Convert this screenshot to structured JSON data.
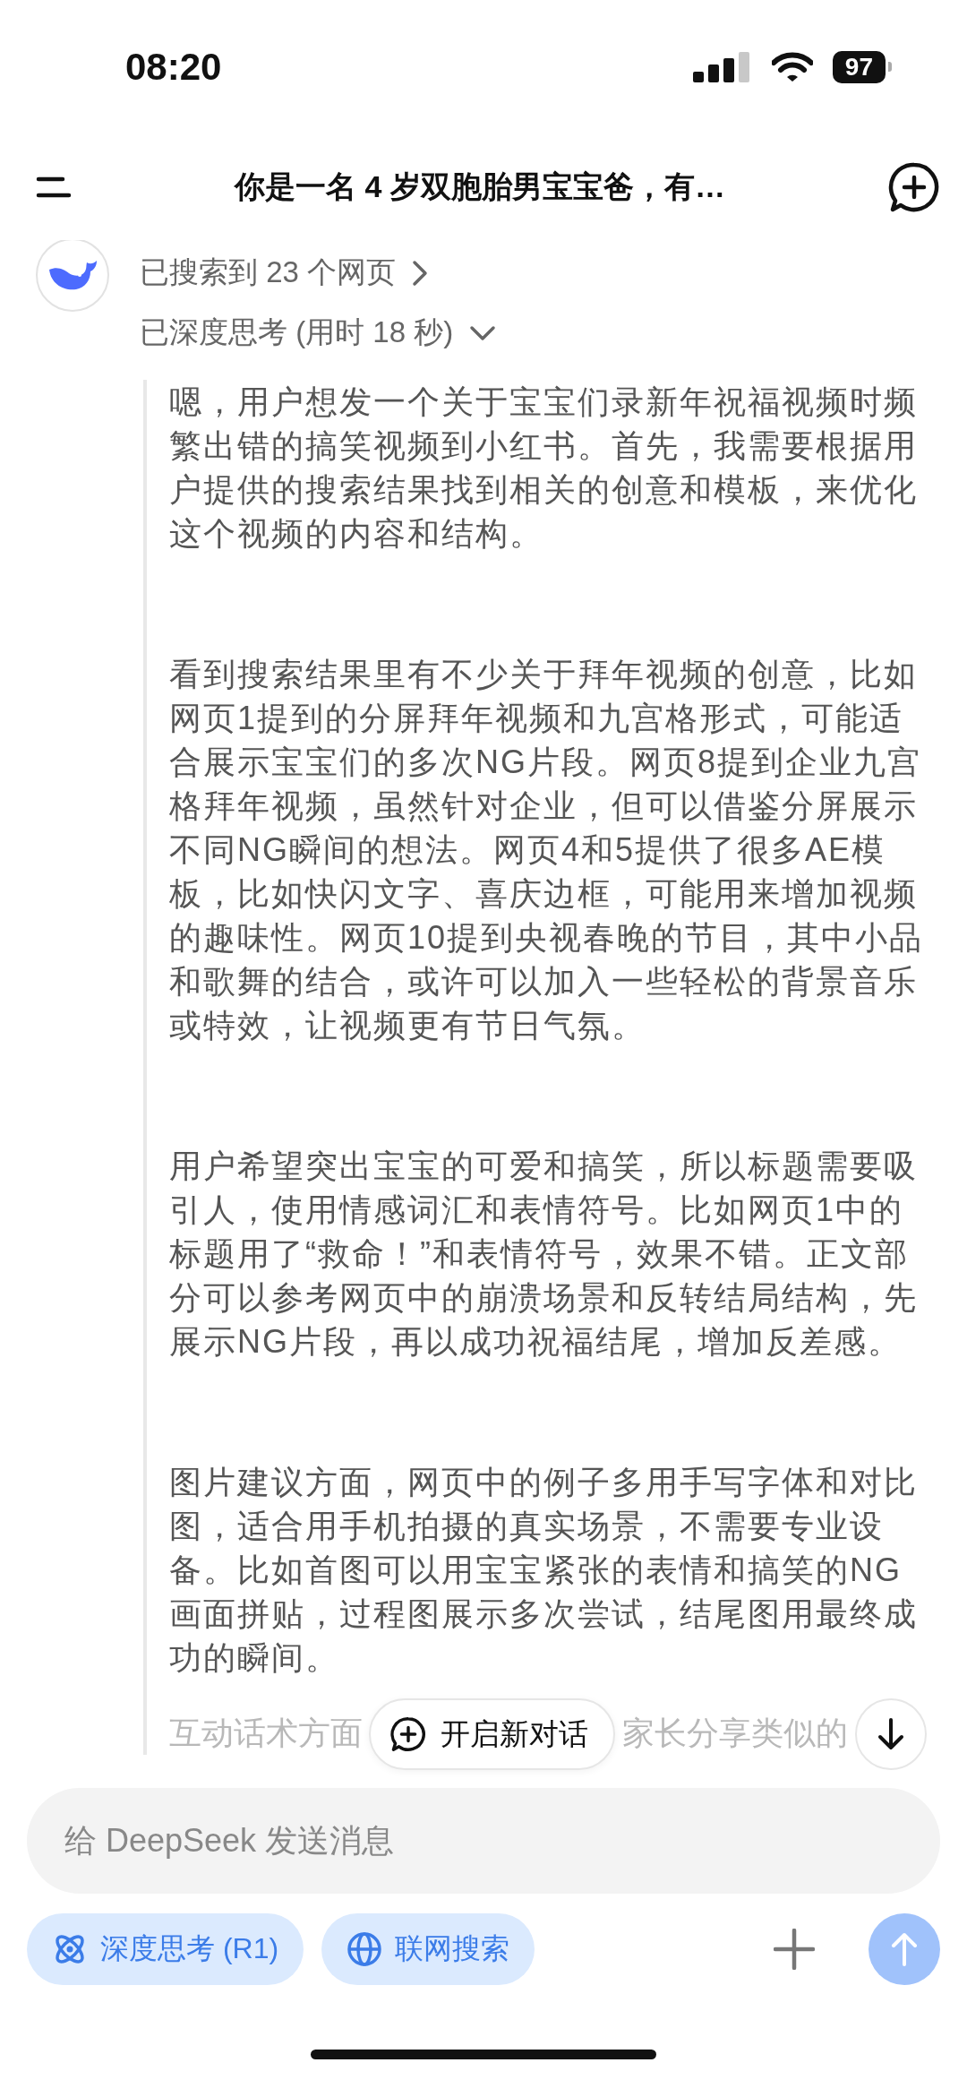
{
  "status_bar": {
    "time": "08:20",
    "battery": "97"
  },
  "header": {
    "title": "你是一名 4 岁双胞胎男宝宝爸，有…"
  },
  "response": {
    "search_summary": "已搜索到 23 个网页",
    "thinking_summary": "已深度思考 (用时 18 秒)",
    "expanded": true,
    "thought_paragraphs": [
      "嗯，用户想发一个关于宝宝们录新年祝福视频时频繁出错的搞笑视频到小红书。首先，我需要根据用户提供的搜索结果找到相关的创意和模板，来优化这个视频的内容和结构。",
      "看到搜索结果里有不少关于拜年视频的创意，比如网页1提到的分屏拜年视频和九宫格形式，可能适合展示宝宝们的多次NG片段。网页8提到企业九宫格拜年视频，虽然针对企业，但可以借鉴分屏展示不同NG瞬间的想法。网页4和5提供了很多AE模板，比如快闪文字、喜庆边框，可能用来增加视频的趣味性。网页10提到央视春晚的节目，其中小品和歌舞的结合，或许可以加入一些轻松的背景音乐或特效，让视频更有节日气氛。",
      "用户希望突出宝宝的可爱和搞笑，所以标题需要吸引人，使用情感词汇和表情符号。比如网页1中的标题用了“救命！”和表情符号，效果不错。正文部分可以参考网页中的崩溃场景和反转结局结构，先展示NG片段，再以成功祝福结尾，增加反差感。",
      "图片建议方面，网页中的例子多用手写字体和对比图，适合用手机拍摄的真实场景，不需要专业设备。比如首图可以用宝宝紧张的表情和搞笑的NG画面拼贴，过程图展示多次尝试，结尾图用最终成功的瞬间。"
    ],
    "faded_line": {
      "left": "互动话术方面",
      "right": "家长分享类似的"
    }
  },
  "new_chat_button": {
    "label": "开启新对话"
  },
  "composer": {
    "placeholder": "给 DeepSeek 发送消息",
    "toggles": [
      {
        "label": "深度思考 (R1)",
        "selected": true
      },
      {
        "label": "联网搜索",
        "selected": true
      }
    ]
  }
}
